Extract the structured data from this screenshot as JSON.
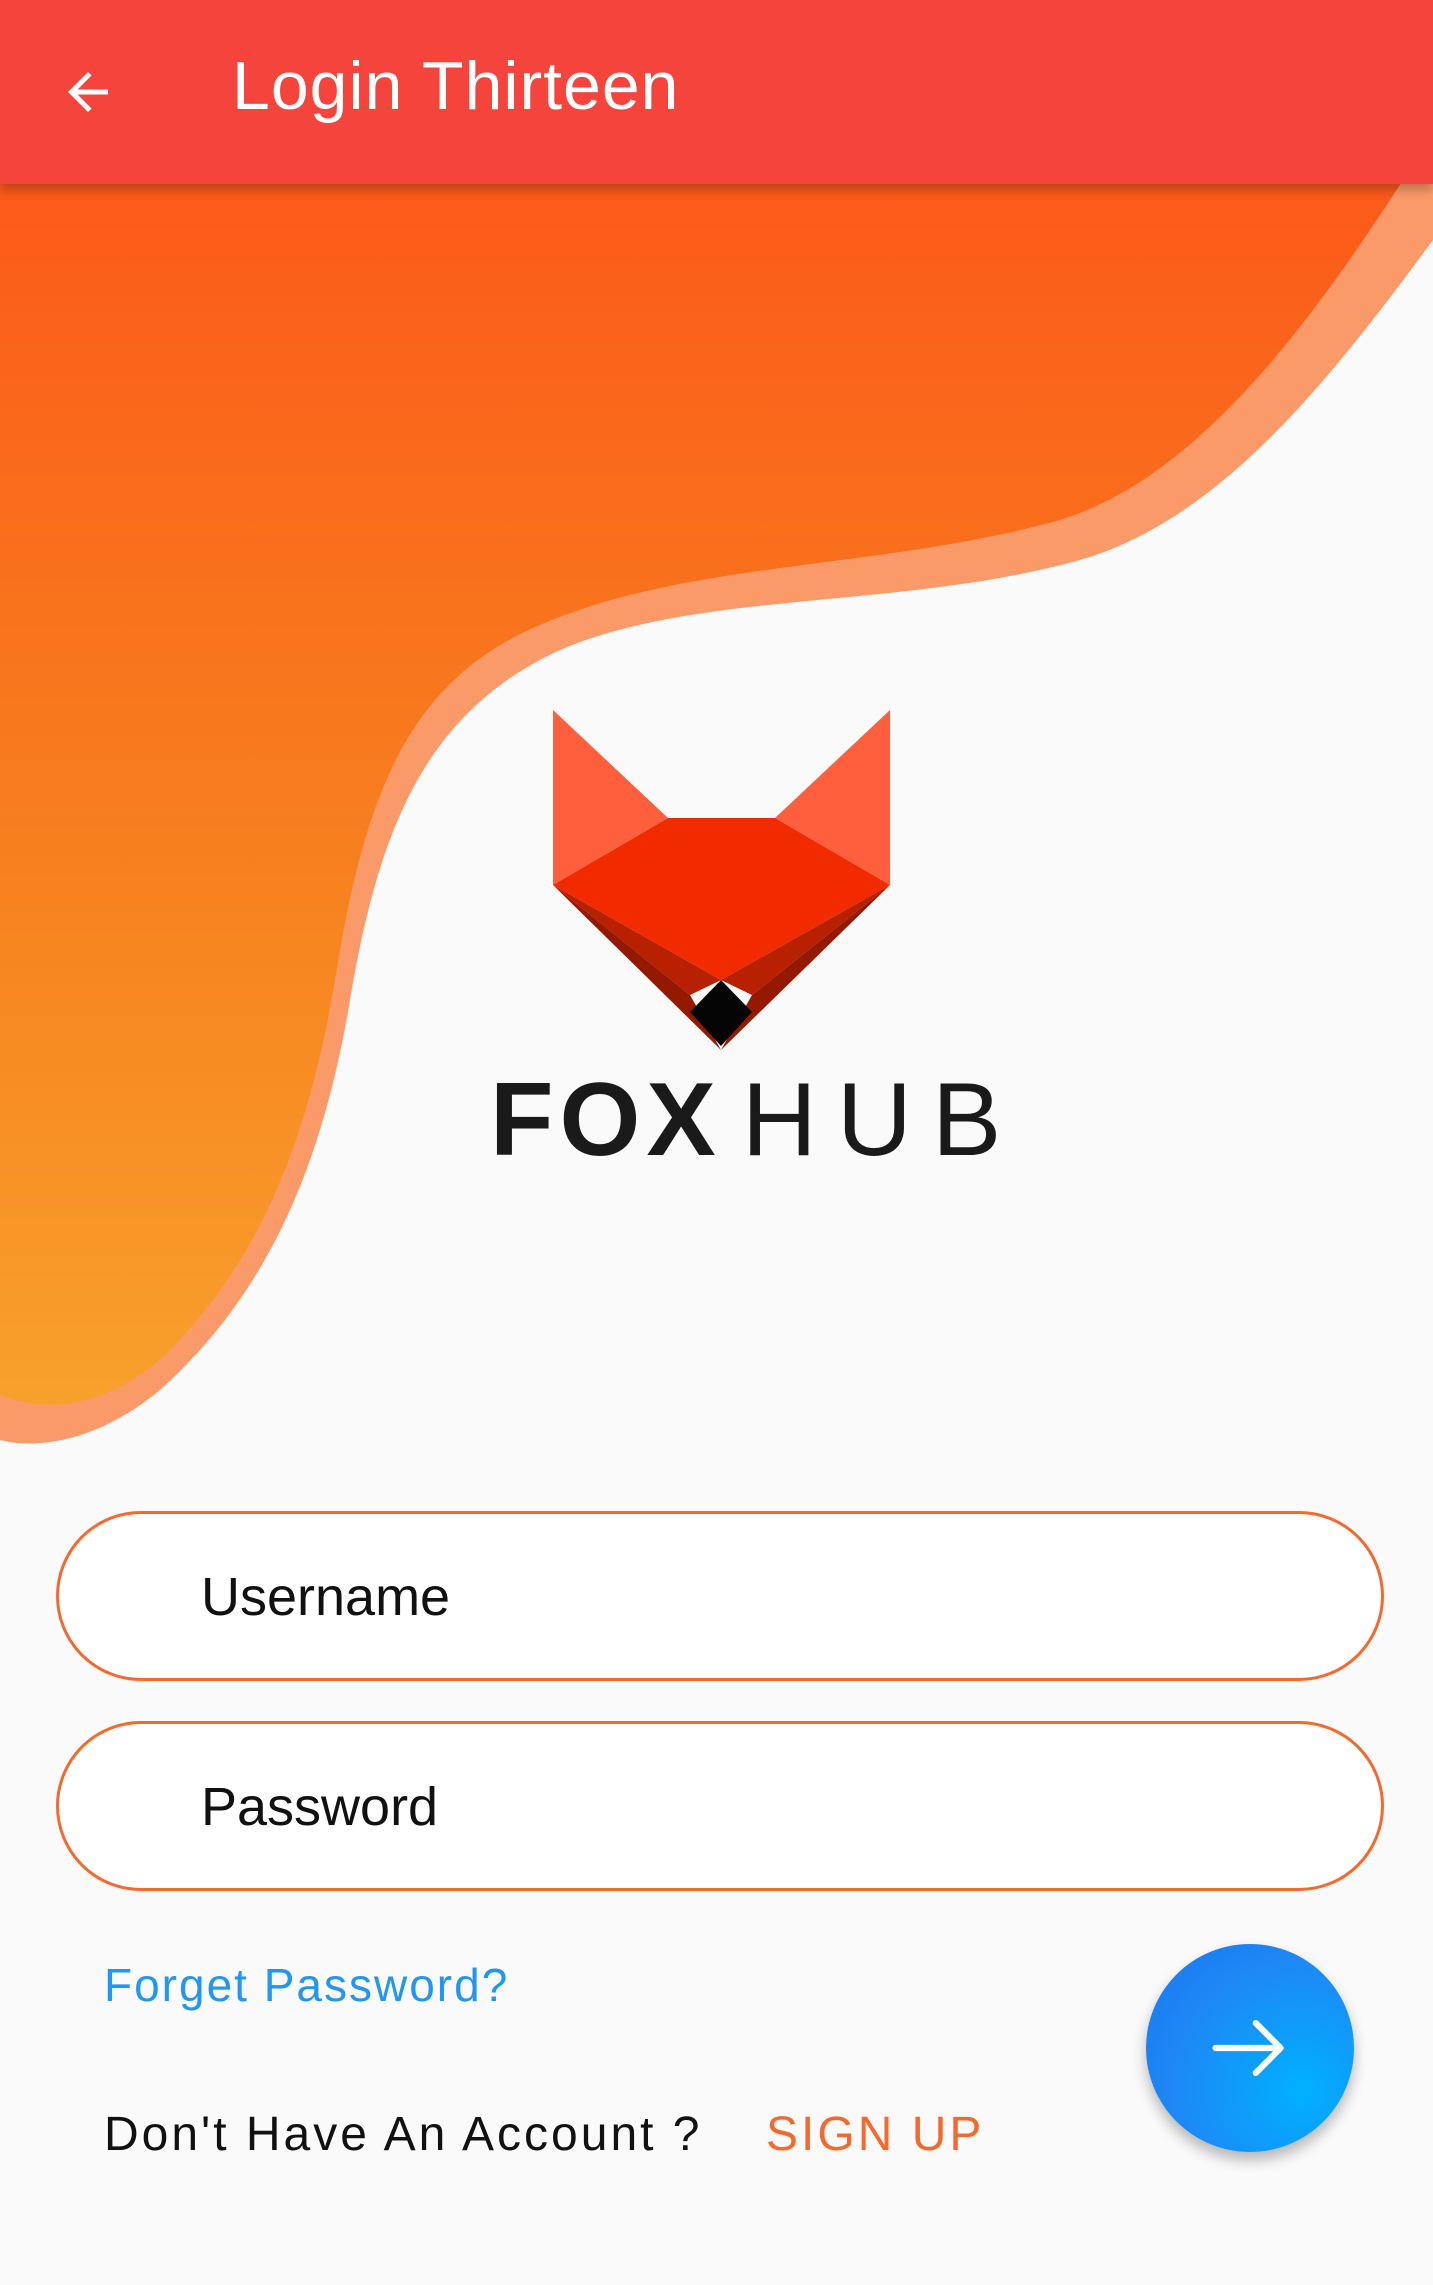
{
  "app_bar": {
    "title": "Login Thirteen",
    "back_icon": "arrow-left-icon",
    "background_color": "#f4443c"
  },
  "header_wave": {
    "gradient_top_color": "#fc5a1a",
    "gradient_bottom_color": "#f8a02c",
    "outline_color": "#fb9a69"
  },
  "logo": {
    "icon": "fox-head-icon",
    "brand_bold": "FOX",
    "brand_light": "HUB"
  },
  "form": {
    "username": {
      "placeholder": "Username",
      "value": ""
    },
    "password": {
      "placeholder": "Password",
      "value": ""
    },
    "border_color": "#f26a2e"
  },
  "links": {
    "forgot_password": "Forget Password?",
    "no_account": "Don't Have An Account ?",
    "sign_up": "SIGN UP",
    "link_color": "#2196f3",
    "accent_color": "#f26a2e"
  },
  "submit": {
    "icon": "arrow-right-icon",
    "color": "#1e88f5"
  }
}
